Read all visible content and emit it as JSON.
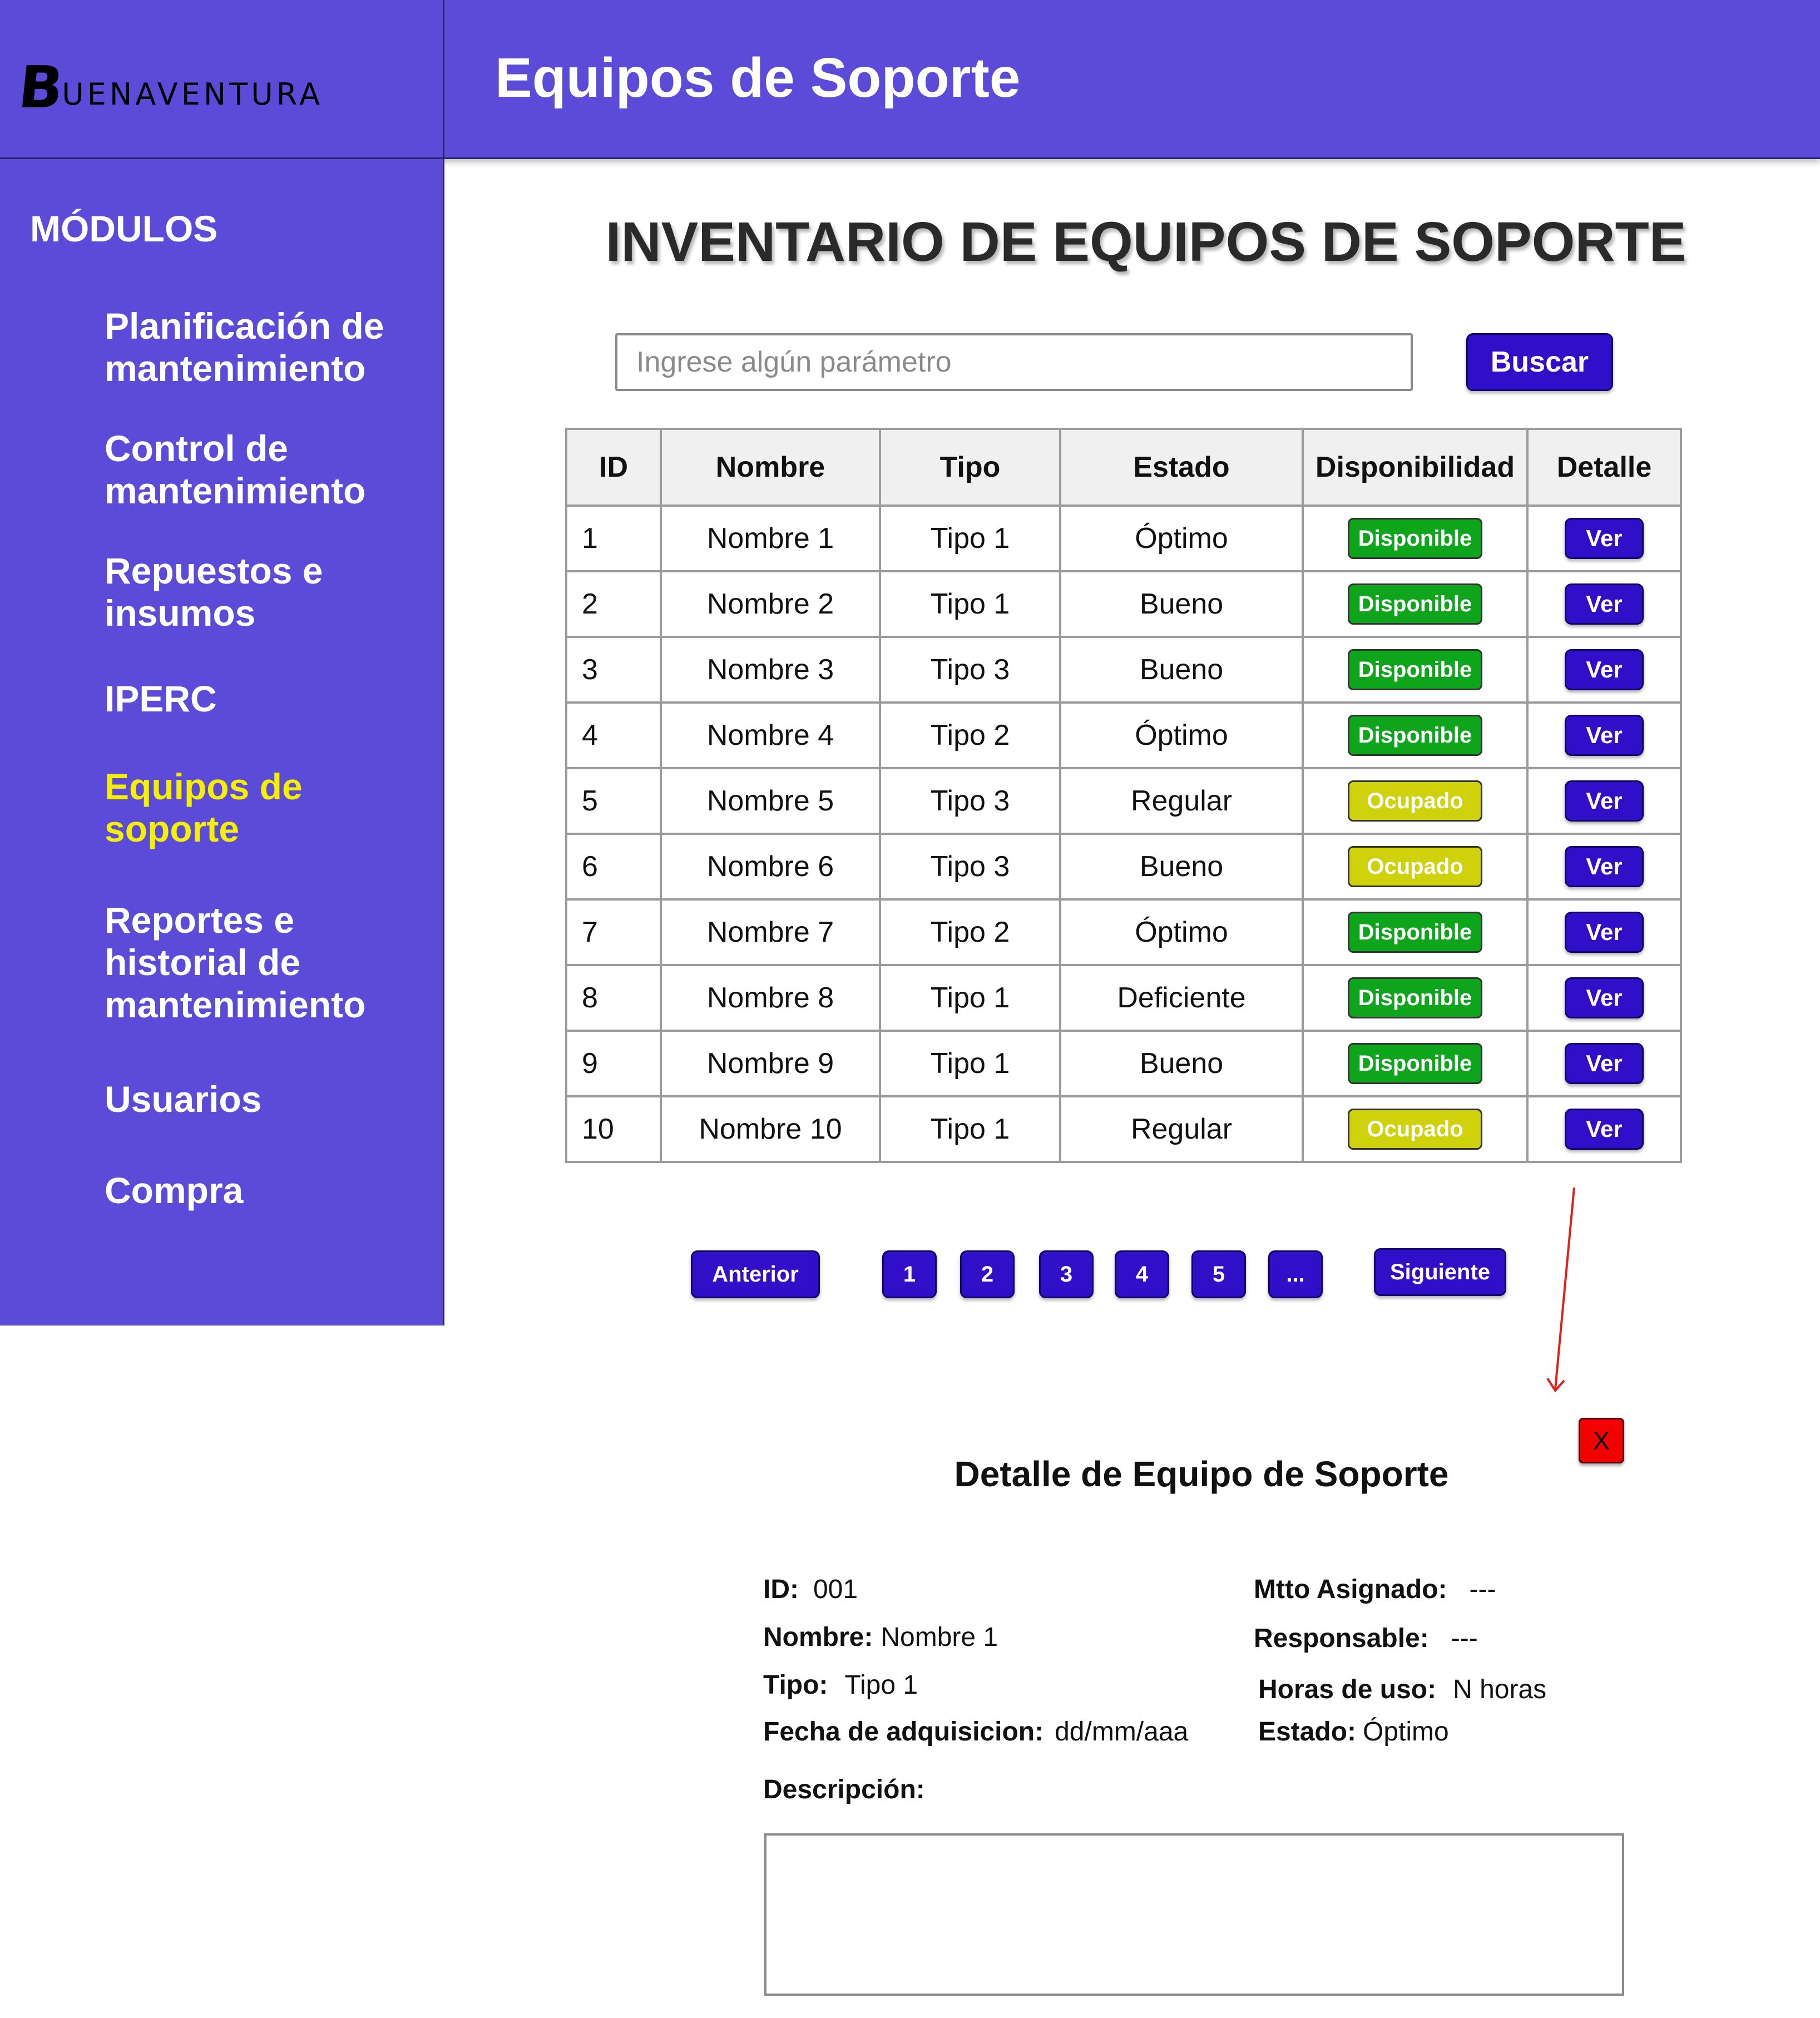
{
  "brand": {
    "logo_initial": "B",
    "logo_rest": "UENAVENTURA"
  },
  "header": {
    "title": "Equipos de Soporte"
  },
  "sidebar": {
    "title": "MÓDULOS",
    "items": [
      {
        "label": "Planificación de mantenimiento",
        "active": false
      },
      {
        "label": "Control de mantenimiento",
        "active": false
      },
      {
        "label": "Repuestos e insumos",
        "active": false
      },
      {
        "label": "IPERC",
        "active": false
      },
      {
        "label": "Equipos de soporte",
        "active": true
      },
      {
        "label": "Reportes e historial de mantenimiento",
        "active": false
      },
      {
        "label": "Usuarios",
        "active": false
      },
      {
        "label": "Compra",
        "active": false
      }
    ],
    "active_color": "#f4f000"
  },
  "main": {
    "title": "INVENTARIO DE EQUIPOS DE SOPORTE"
  },
  "search": {
    "placeholder": "Ingrese algún parámetro",
    "value": "",
    "button_label": "Buscar"
  },
  "table": {
    "headers": [
      "ID",
      "Nombre",
      "Tipo",
      "Estado",
      "Disponibilidad",
      "Detalle"
    ],
    "rows": [
      {
        "id": "1",
        "nombre": "Nombre 1",
        "tipo": "Tipo 1",
        "estado": "Óptimo",
        "disponibilidad": "Disponible",
        "detalle": "Ver"
      },
      {
        "id": "2",
        "nombre": "Nombre 2",
        "tipo": "Tipo 1",
        "estado": "Bueno",
        "disponibilidad": "Disponible",
        "detalle": "Ver"
      },
      {
        "id": "3",
        "nombre": "Nombre 3",
        "tipo": "Tipo 3",
        "estado": "Bueno",
        "disponibilidad": "Disponible",
        "detalle": "Ver"
      },
      {
        "id": "4",
        "nombre": "Nombre 4",
        "tipo": "Tipo 2",
        "estado": "Óptimo",
        "disponibilidad": "Disponible",
        "detalle": "Ver"
      },
      {
        "id": "5",
        "nombre": "Nombre 5",
        "tipo": "Tipo 3",
        "estado": "Regular",
        "disponibilidad": "Ocupado",
        "detalle": "Ver"
      },
      {
        "id": "6",
        "nombre": "Nombre 6",
        "tipo": "Tipo 3",
        "estado": "Bueno",
        "disponibilidad": "Ocupado",
        "detalle": "Ver"
      },
      {
        "id": "7",
        "nombre": "Nombre 7",
        "tipo": "Tipo 2",
        "estado": "Óptimo",
        "disponibilidad": "Disponible",
        "detalle": "Ver"
      },
      {
        "id": "8",
        "nombre": "Nombre 8",
        "tipo": "Tipo 1",
        "estado": "Deficiente",
        "disponibilidad": "Disponible",
        "detalle": "Ver"
      },
      {
        "id": "9",
        "nombre": "Nombre 9",
        "tipo": "Tipo 1",
        "estado": "Bueno",
        "disponibilidad": "Disponible",
        "detalle": "Ver"
      },
      {
        "id": "10",
        "nombre": "Nombre 10",
        "tipo": "Tipo 1",
        "estado": "Regular",
        "disponibilidad": "Ocupado",
        "detalle": "Ver"
      }
    ],
    "status_colors": {
      "Disponible": "#0ea51c",
      "Ocupado": "#cfd10b"
    }
  },
  "pagination": {
    "prev_label": "Anterior",
    "pages": [
      "1",
      "2",
      "3",
      "4",
      "5",
      "..."
    ],
    "next_label": "Siguiente"
  },
  "detail": {
    "title": "Detalle de Equipo de Soporte",
    "close_label": "X",
    "fields": {
      "id": {
        "label": "ID:",
        "value": "001"
      },
      "nombre": {
        "label": "Nombre:",
        "value": "Nombre 1"
      },
      "tipo": {
        "label": "Tipo:",
        "value": "Tipo 1"
      },
      "fecha": {
        "label": "Fecha de adquisicion:",
        "value": "dd/mm/aaa"
      },
      "mtto": {
        "label": "Mtto Asignado:",
        "value": "---"
      },
      "responsable": {
        "label": "Responsable:",
        "value": "---"
      },
      "horas": {
        "label": "Horas de uso:",
        "value": "N horas"
      },
      "estado": {
        "label": "Estado:",
        "value": "Óptimo"
      }
    },
    "description_label": "Descripción:",
    "description_value": ""
  },
  "colors": {
    "primary": "#5c4ad8",
    "button": "#2f0fc7",
    "close": "#f40000",
    "arrow": "#e0201a"
  }
}
